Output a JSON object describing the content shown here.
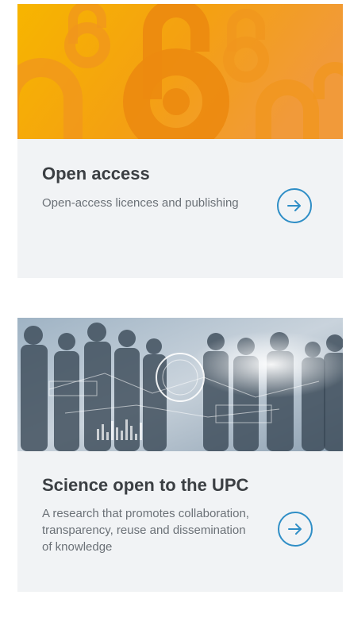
{
  "cards": [
    {
      "title": "Open access",
      "description": "Open-access licences and publishing",
      "image_icon": "open-access-lock-icon",
      "arrow_icon": "arrow-right-icon"
    },
    {
      "title": "Science open to the UPC",
      "description": "A research that promotes collaboration, transparency, reuse and dissemination of knowledge",
      "image_icon": "people-network-photo",
      "arrow_icon": "arrow-right-icon"
    }
  ],
  "colors": {
    "card_background": "#f1f3f5",
    "accent": "#2f8ec6",
    "title": "#3b3f43",
    "description": "#6b7177",
    "open_access_orange": "#f4a012"
  }
}
